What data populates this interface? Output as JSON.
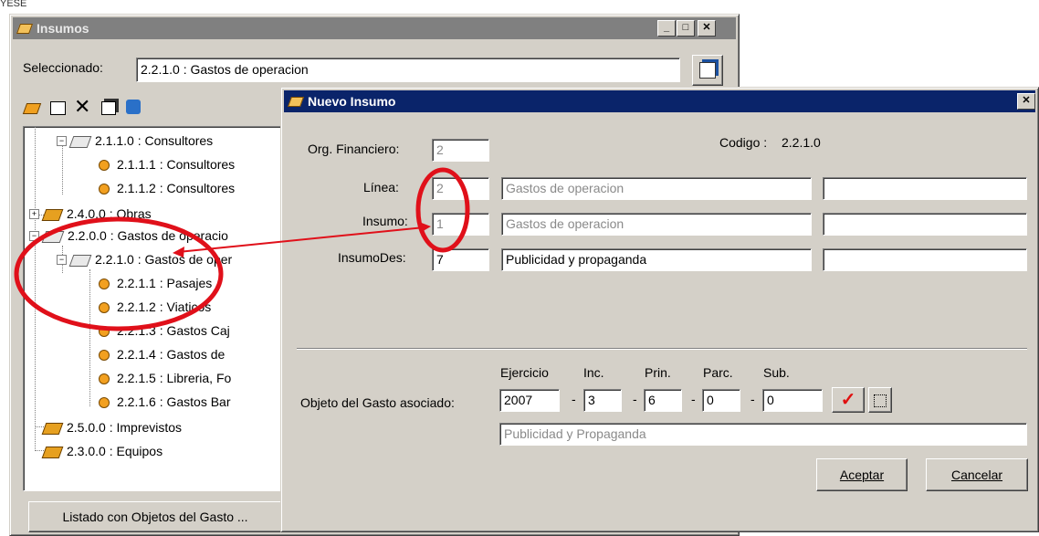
{
  "background_text": {
    "top_fragment": "YESE"
  },
  "insumos_window": {
    "title": "Insumos",
    "selected_label": "Seleccionado:",
    "selected_value": "2.2.1.0 : Gastos de operacion",
    "list_button": "Listado con Objetos del Gasto ...",
    "tree": [
      {
        "label": "2.1.1.0 : Consultores",
        "icon": "open-book-icon"
      },
      {
        "label": "2.1.1.1 : Consultores",
        "icon": "dot-icon"
      },
      {
        "label": "2.1.1.2 : Consultores",
        "icon": "dot-icon"
      },
      {
        "label": "2.4.0.0 : Obras",
        "icon": "book-icon"
      },
      {
        "label": "2.2.0.0 : Gastos de operacio",
        "icon": "open-book-icon"
      },
      {
        "label": "2.2.1.0 : Gastos de oper",
        "icon": "open-book-icon"
      },
      {
        "label": "2.2.1.1 : Pasajes",
        "icon": "dot-icon"
      },
      {
        "label": "2.2.1.2 : Viaticos",
        "icon": "dot-icon"
      },
      {
        "label": "2.2.1.3 : Gastos Caj",
        "icon": "dot-icon"
      },
      {
        "label": "2.2.1.4 : Gastos de",
        "icon": "dot-icon"
      },
      {
        "label": "2.2.1.5 : Libreria, Fo",
        "icon": "dot-icon"
      },
      {
        "label": "2.2.1.6 : Gastos Bar",
        "icon": "dot-icon"
      },
      {
        "label": "2.5.0.0 : Imprevistos",
        "icon": "book-icon"
      },
      {
        "label": "2.3.0.0 : Equipos",
        "icon": "book-icon"
      }
    ]
  },
  "nuevo_dialog": {
    "title": "Nuevo Insumo",
    "codigo_label": "Codigo :",
    "codigo_value": "2.2.1.0",
    "org_label": "Org. Financiero:",
    "org_value": "2",
    "linea_label": "Línea:",
    "linea_value": "2",
    "linea_desc": "Gastos de operacion",
    "insumo_label": "Insumo:",
    "insumo_value": "1",
    "insumo_desc": "Gastos de operacion",
    "insumodes_label": "InsumoDes:",
    "insumodes_value": "7",
    "insumodes_desc": "Publicidad y propaganda",
    "objeto_label": "Objeto del Gasto asociado:",
    "col_ejercicio": "Ejercicio",
    "col_inc": "Inc.",
    "col_prin": "Prin.",
    "col_parc": "Parc.",
    "col_sub": "Sub.",
    "ejercicio_value": "2007",
    "inc_value": "3",
    "prin_value": "6",
    "parc_value": "0",
    "sub_value": "0",
    "separator": "-",
    "objeto_desc": "Publicidad y Propaganda",
    "accept_button": "Aceptar",
    "cancel_button": "Cancelar"
  },
  "colors": {
    "titlebar_active": "#0a246a",
    "titlebar_inactive": "#808080",
    "annotation": "#e0101a"
  }
}
